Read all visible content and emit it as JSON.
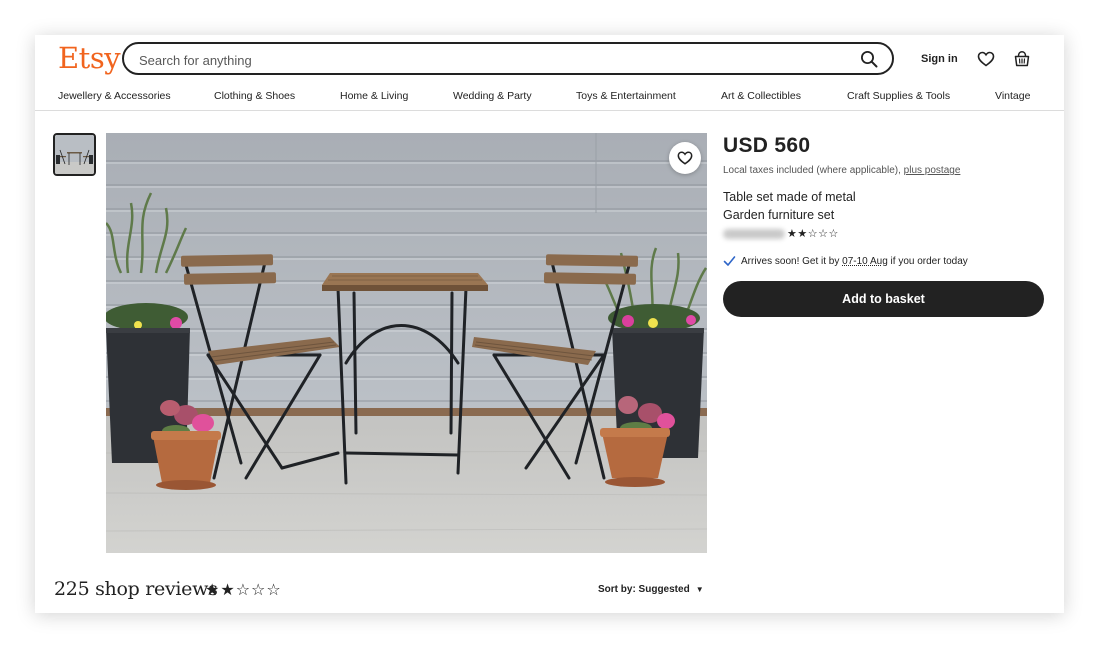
{
  "header": {
    "logo": "Etsy",
    "search_placeholder": "Search for anything",
    "signin_label": "Sign in",
    "icons": [
      "search-icon",
      "heart-icon",
      "basket-icon"
    ]
  },
  "nav": {
    "items": [
      "Jewellery & Accessories",
      "Clothing & Shoes",
      "Home & Living",
      "Wedding & Party",
      "Toys & Entertainment",
      "Art & Collectibles",
      "Craft Supplies & Tools",
      "Vintage"
    ]
  },
  "listing": {
    "price": "USD 560",
    "taxes_text": "Local taxes included (where applicable), ",
    "taxes_link": "plus postage",
    "title_line1": "Table set made of metal",
    "title_line2": "Garden furniture set",
    "shop_rating": 2,
    "shop_rating_max": 5,
    "shop_stars": "★★☆☆☆",
    "arrives_prefix": "Arrives soon! Get it by ",
    "arrives_dates": "07-10 Aug",
    "arrives_suffix": " if you order today",
    "add_to_basket_label": "Add to basket"
  },
  "reviews": {
    "title": "225 shop reviews",
    "stars": "★★☆☆☆",
    "rating": 2,
    "rating_max": 5,
    "sort_label": "Sort by: Suggested",
    "sort_caret": "▼"
  },
  "colors": {
    "brand": "#F1641E",
    "button_bg": "#222222",
    "text": "#222222"
  }
}
